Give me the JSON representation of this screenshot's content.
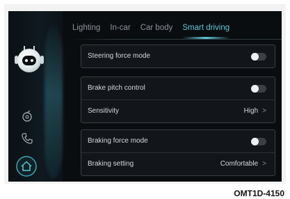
{
  "tabs": [
    {
      "label": "Lighting",
      "active": false
    },
    {
      "label": "In-car",
      "active": false
    },
    {
      "label": "Car body",
      "active": false
    },
    {
      "label": "Smart driving",
      "active": true
    }
  ],
  "accent_color": "#5ec8d6",
  "sidebar": {
    "avatar_icon": "robot-avatar-icon",
    "items": [
      {
        "icon": "steering-assist-icon"
      },
      {
        "icon": "phone-icon"
      },
      {
        "icon": "home-icon"
      }
    ]
  },
  "settings": {
    "steering_force_mode": {
      "label": "Steering force mode",
      "enabled": false
    },
    "brake_pitch_control": {
      "label": "Brake pitch control",
      "enabled": false
    },
    "sensitivity": {
      "label": "Sensitivity",
      "value": "High",
      "chevron": ">"
    },
    "braking_force_mode": {
      "label": "Braking force mode",
      "enabled": false
    },
    "braking_setting": {
      "label": "Braking setting",
      "value": "Comfortable",
      "chevron": ">"
    }
  },
  "figure_code": "OMT1D-4150"
}
